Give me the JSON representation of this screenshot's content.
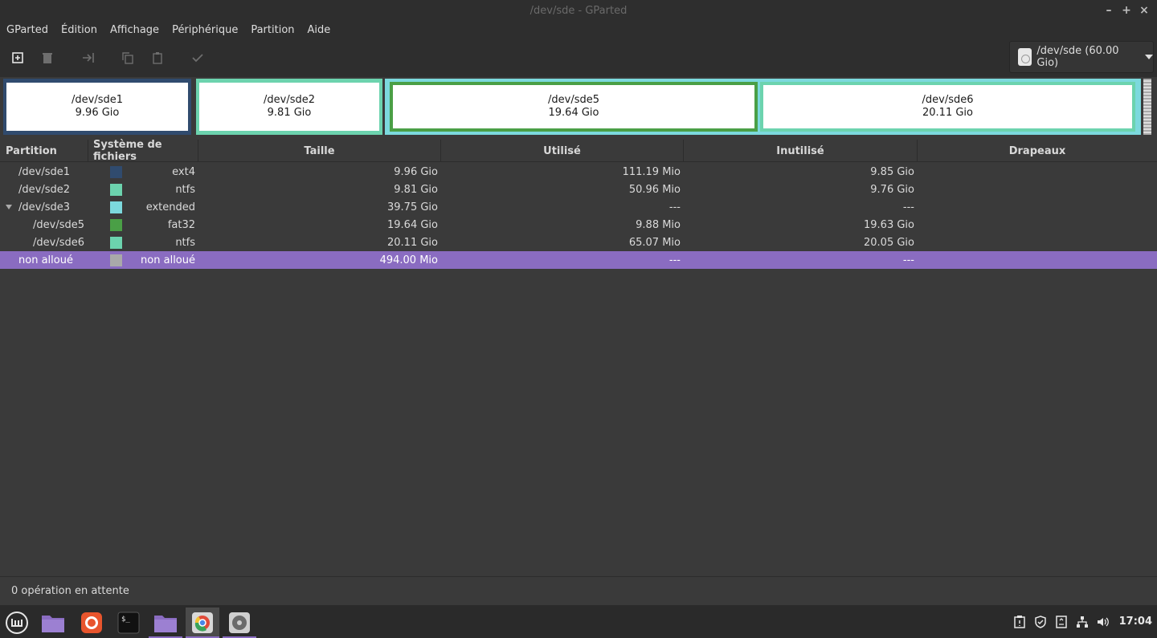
{
  "window": {
    "title": "/dev/sde - GParted"
  },
  "window_controls": {
    "minimize": "–",
    "maximize": "+",
    "close": "×"
  },
  "menu": [
    "GParted",
    "Édition",
    "Affichage",
    "Périphérique",
    "Partition",
    "Aide"
  ],
  "toolbar": {
    "buttons": [
      "new-icon",
      "delete-icon",
      "resize-move-icon",
      "copy-icon",
      "paste-icon",
      "apply-icon"
    ]
  },
  "device_selector": {
    "label": "/dev/sde (60.00 Gio)"
  },
  "disk_map": [
    {
      "name": "/dev/sde1",
      "size": "9.96 Gio",
      "color": "#304b6e"
    },
    {
      "name": "/dev/sde2",
      "size": "9.81 Gio",
      "color": "#6cd3ae"
    },
    {
      "name": "/dev/sde5",
      "size": "19.64 Gio",
      "color": "#4a9f46"
    },
    {
      "name": "/dev/sde6",
      "size": "20.11 Gio",
      "color": "#6cd3ae"
    }
  ],
  "colors": {
    "extended": "#7cd9dd",
    "selection": "#8a6cc1",
    "unallocated": "#a9a9a9"
  },
  "table": {
    "headers": [
      "Partition",
      "Système de fichiers",
      "Taille",
      "Utilisé",
      "Inutilisé",
      "Drapeaux"
    ],
    "rows": [
      {
        "partition": "/dev/sde1",
        "fs": "ext4",
        "color": "#304b6e",
        "size": "9.96 Gio",
        "used": "111.19 Mio",
        "unused": "9.85 Gio",
        "flags": ""
      },
      {
        "partition": "/dev/sde2",
        "fs": "ntfs",
        "color": "#6cd3ae",
        "size": "9.81 Gio",
        "used": "50.96 Mio",
        "unused": "9.76 Gio",
        "flags": ""
      },
      {
        "partition": "/dev/sde3",
        "fs": "extended",
        "color": "#7cd9dd",
        "size": "39.75 Gio",
        "used": "---",
        "unused": "---",
        "flags": ""
      },
      {
        "partition": "/dev/sde5",
        "fs": "fat32",
        "color": "#4a9f46",
        "size": "19.64 Gio",
        "used": "9.88 Mio",
        "unused": "19.63 Gio",
        "flags": ""
      },
      {
        "partition": "/dev/sde6",
        "fs": "ntfs",
        "color": "#6cd3ae",
        "size": "20.11 Gio",
        "used": "65.07 Mio",
        "unused": "20.05 Gio",
        "flags": ""
      },
      {
        "partition": "non alloué",
        "fs": "non alloué",
        "color": "#a9a9a9",
        "size": "494.00 Mio",
        "used": "---",
        "unused": "---",
        "flags": ""
      }
    ]
  },
  "status": {
    "text": "0 opération en attente"
  },
  "taskbar": {
    "apps": [
      "mint-menu-icon",
      "files-icon",
      "firefox-icon",
      "terminal-icon",
      "files-icon",
      "chromium-icon",
      "gparted-icon"
    ]
  },
  "tray": {
    "icons": [
      "clipboard-icon",
      "shield-icon",
      "document-icon",
      "network-icon",
      "volume-icon"
    ],
    "clock": "17:04"
  }
}
